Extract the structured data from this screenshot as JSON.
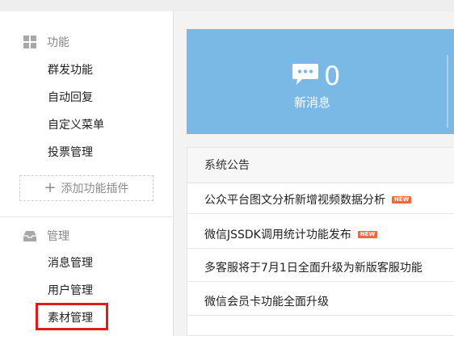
{
  "sidebar": {
    "sections": [
      {
        "title": "功能",
        "icon": "grid-icon",
        "items": [
          "群发功能",
          "自动回复",
          "自定义菜单",
          "投票管理"
        ],
        "add_button": "添加功能插件"
      },
      {
        "title": "管理",
        "icon": "inbox-icon",
        "items": [
          "消息管理",
          "用户管理",
          "素材管理"
        ]
      }
    ],
    "highlighted_item": "素材管理",
    "highlight_color": "#e01c1c"
  },
  "stats": {
    "count": "0",
    "label": "新消息",
    "icon": "chat-bubble-icon",
    "color": "#7ab8e6"
  },
  "notices": {
    "header": "系统公告",
    "badge_text": "NEW",
    "badge_color": "#f3683b",
    "items": [
      {
        "text": "公众平台图文分析新增视频数据分析",
        "new": true
      },
      {
        "text": "微信JSSDK调用统计功能发布",
        "new": true
      },
      {
        "text": "多客服将于7月1日全面升级为新版客服功能",
        "new": false
      },
      {
        "text": "微信会员卡功能全面升级",
        "new": false
      }
    ]
  }
}
